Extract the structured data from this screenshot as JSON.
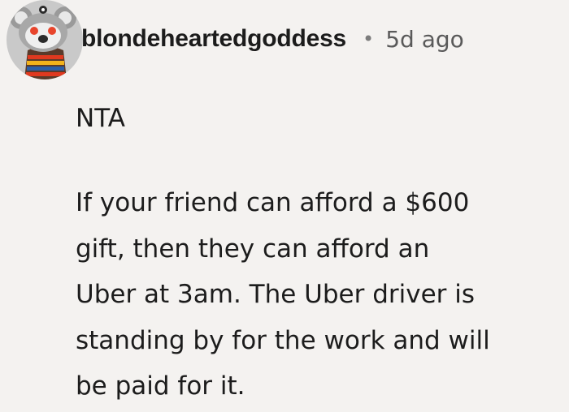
{
  "comment": {
    "author": {
      "username": "blondeheartedgoddess",
      "avatar_icon": "koala-snoo-avatar-icon"
    },
    "separator": "•",
    "timestamp": "5d ago",
    "verdict": "NTA",
    "body_lines": [
      "If your friend can afford a $600",
      "gift, then they can afford an",
      "Uber at 3am. The Uber driver is",
      "standing by for the work and will",
      "be paid for it."
    ]
  },
  "colors": {
    "background": "#f4f2f0",
    "text": "#1c1c1c",
    "meta_text": "#5a5a5a",
    "avatar_bg": "#c9c9c9",
    "avatar_eye": "#e8452c",
    "avatar_stripe_red": "#e0391f",
    "avatar_stripe_yellow": "#f2b21c",
    "avatar_stripe_blue": "#2a5ea8"
  }
}
